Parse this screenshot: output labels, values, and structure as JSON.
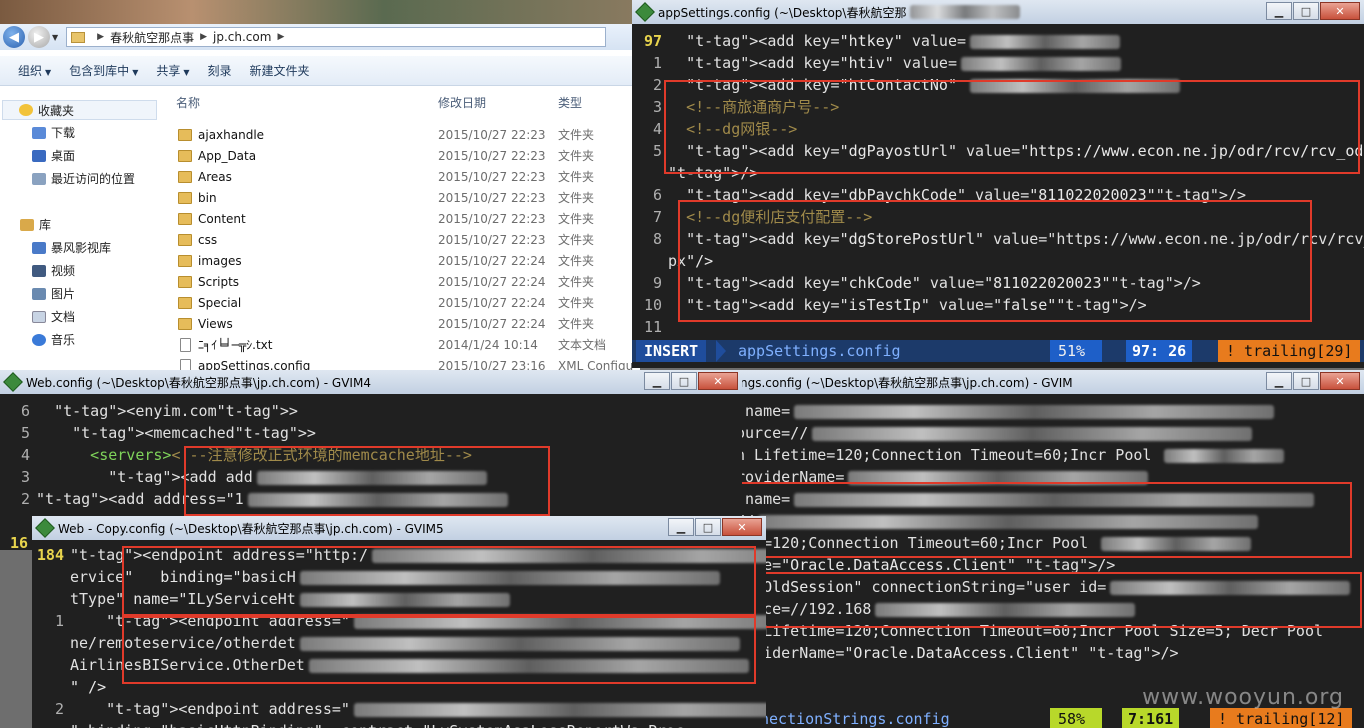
{
  "explorer": {
    "path": [
      "春秋航空那点事",
      "jp.ch.com"
    ],
    "toolbar": [
      "组织",
      "包含到库中",
      "共享",
      "刻录",
      "新建文件夹"
    ],
    "nav": {
      "favorites": "收藏夹",
      "fav_items": [
        "下载",
        "桌面",
        "最近访问的位置"
      ],
      "library": "库",
      "lib_items": [
        "暴风影视库",
        "视频",
        "图片",
        "文档",
        "音乐"
      ]
    },
    "columns": {
      "name": "名称",
      "date": "修改日期",
      "type": "类型"
    },
    "files": [
      {
        "name": "ajaxhandle",
        "date": "2015/10/27 22:23",
        "type": "文件夹",
        "kind": "folder"
      },
      {
        "name": "App_Data",
        "date": "2015/10/27 22:23",
        "type": "文件夹",
        "kind": "folder"
      },
      {
        "name": "Areas",
        "date": "2015/10/27 22:23",
        "type": "文件夹",
        "kind": "folder"
      },
      {
        "name": "bin",
        "date": "2015/10/27 22:23",
        "type": "文件夹",
        "kind": "folder"
      },
      {
        "name": "Content",
        "date": "2015/10/27 22:23",
        "type": "文件夹",
        "kind": "folder"
      },
      {
        "name": "css",
        "date": "2015/10/27 22:23",
        "type": "文件夹",
        "kind": "folder"
      },
      {
        "name": "images",
        "date": "2015/10/27 22:24",
        "type": "文件夹",
        "kind": "folder"
      },
      {
        "name": "Scripts",
        "date": "2015/10/27 22:24",
        "type": "文件夹",
        "kind": "folder"
      },
      {
        "name": "Special",
        "date": "2015/10/27 22:24",
        "type": "文件夹",
        "kind": "folder"
      },
      {
        "name": "Views",
        "date": "2015/10/27 22:24",
        "type": "文件夹",
        "kind": "folder"
      },
      {
        "name": "ﾆ╕ｲ╘╛─╦ｼ.txt",
        "date": "2014/1/24 10:14",
        "type": "文本文档",
        "kind": "doc"
      },
      {
        "name": "appSettings.config",
        "date": "2015/10/27 23:16",
        "type": "XML Configu",
        "kind": "doc"
      }
    ]
  },
  "app_settings": {
    "title": "appSettings.config (~\\Desktop\\春秋航空那",
    "lines": [
      {
        "n": "97",
        "cur": true,
        "text": "  <add key=\"htkey\" value="
      },
      {
        "n": "1",
        "text": "  <add key=\"htiv\" value="
      },
      {
        "n": "2",
        "text": "  <add key=\"htContactNo\" "
      },
      {
        "n": "3",
        "text": "  <!--商旅通商户号-->"
      },
      {
        "n": "4",
        "text": "  <!--dg网银-->"
      },
      {
        "n": "5",
        "text": "  <add key=\"dgPayostUrl\" value=\"https://www.econ.ne.jp/odr/rcv/rcv_odr.aspx\""
      },
      {
        "n": "",
        "text": "/>"
      },
      {
        "n": "6",
        "text": "  <add key=\"dbPaychkCode\" value=\"811022020023\"/>"
      },
      {
        "n": "7",
        "text": "  <!--dg便利店支付配置-->"
      },
      {
        "n": "8",
        "text": "  <add key=\"dgStorePostUrl\" value=\"https://www.econ.ne.jp/odr/rcv/rcv_odr.as"
      },
      {
        "n": "",
        "text": "px\"/>"
      },
      {
        "n": "9",
        "text": "  <add key=\"chkCode\" value=\"811022020023\"/>"
      },
      {
        "n": "10",
        "text": "  <add key=\"isTestIp\" value=\"false\"/>"
      },
      {
        "n": "11",
        "text": ""
      }
    ],
    "status": {
      "mode": "INSERT",
      "file": "appSettings.config",
      "pct": "51% ",
      "pos": "97: 26",
      "warn": "! trailing[29]"
    }
  },
  "conn_strings": {
    "title": "ngs.config (~\\Desktop\\春秋航空那点事\\jp.ch.com) - GVIM",
    "lines": [
      " name=",
      "ource=//",
      "n Lifetime=120;Connection Timeout=60;Incr Pool ",
      "roviderName=",
      " name=",
      "//",
      "ime=120;Connection Timeout=60;Incr Pool ",
      "name=\"Oracle.DataAccess.Client\" />",
      "e=\"OldSession\" connectionString=\"user id=",
      "ource=//192.168",
      "on Lifetime=120;Connection Timeout=60;Incr Pool Size=5; Decr Pool",
      "roviderName=\"Oracle.DataAccess.Client\" />"
    ],
    "status": {
      "file": "nectionStrings.config",
      "pct": "58% ",
      "pos": "7:161",
      "warn": "! trailing[12]"
    }
  },
  "web_config": {
    "title": "Web.config (~\\Desktop\\春秋航空那点事\\jp.ch.com) - GVIM4",
    "lines": [
      {
        "n": "6",
        "text": "  <enyim.com>"
      },
      {
        "n": "5",
        "text": "    <memcached>"
      },
      {
        "n": "4",
        "text": "      <servers><!--注意修改正式环境的memcache地址-->"
      },
      {
        "n": "3",
        "text": "        <add add"
      },
      {
        "n": "2",
        "text": "<add address=\"1"
      }
    ],
    "partial_line": "16"
  },
  "web_copy": {
    "title": "Web - Copy.config (~\\Desktop\\春秋航空那点事\\jp.ch.com) - GVIM5",
    "lines": [
      {
        "n": "184",
        "cur": true,
        "text": "<endpoint address=\"http:/"
      },
      {
        "n": "",
        "text": "ervice\"   binding=\"basicH"
      },
      {
        "n": "",
        "text": "tType\" name=\"ILyServiceHt"
      },
      {
        "n": "1",
        "text": "    <endpoint address=\""
      },
      {
        "n": "",
        "text": "ne/remoteservice/otherdet"
      },
      {
        "n": "",
        "text": "AirlinesBIService.OtherDet"
      },
      {
        "n": "",
        "text": "\" />"
      },
      {
        "n": "2",
        "text": "    <endpoint address=\""
      },
      {
        "n": "",
        "text": "\" binding=\"basicHttpBinding\"  contract=\"LySystemAsaLossReportWs.Proc"
      }
    ]
  },
  "watermark": "www.wooyun.org"
}
